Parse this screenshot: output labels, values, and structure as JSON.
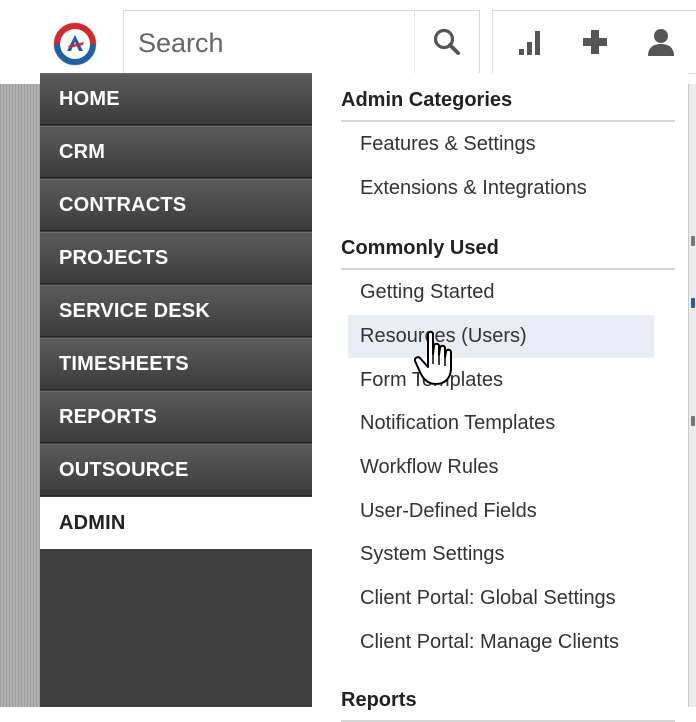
{
  "app": {
    "logo": "autotask-logo-icon",
    "brand_colors": {
      "red": "#d9262b",
      "blue": "#1f5fa8"
    }
  },
  "search": {
    "placeholder": "Search",
    "value": "",
    "icon": "search-icon"
  },
  "toolbar": {
    "icons": [
      "bar-chart-icon",
      "plus-icon",
      "user-icon"
    ]
  },
  "nav": {
    "items": [
      {
        "label": "HOME",
        "active": false
      },
      {
        "label": "CRM",
        "active": false
      },
      {
        "label": "CONTRACTS",
        "active": false
      },
      {
        "label": "PROJECTS",
        "active": false
      },
      {
        "label": "SERVICE DESK",
        "active": false
      },
      {
        "label": "TIMESHEETS",
        "active": false
      },
      {
        "label": "REPORTS",
        "active": false
      },
      {
        "label": "OUTSOURCE",
        "active": false
      },
      {
        "label": "ADMIN",
        "active": true
      }
    ]
  },
  "panel": {
    "sections": [
      {
        "title": "Admin Categories",
        "links": [
          "Features & Settings",
          "Extensions & Integrations"
        ]
      },
      {
        "title": "Commonly Used",
        "links": [
          "Getting Started",
          "Resources (Users)",
          "Form Templates",
          "Notification Templates",
          "Workflow Rules",
          "User-Defined Fields",
          "System Settings",
          "Client Portal: Global Settings",
          "Client Portal: Manage Clients"
        ]
      },
      {
        "title": "Reports",
        "links": []
      }
    ],
    "hovered_link": "Resources (Users)"
  }
}
